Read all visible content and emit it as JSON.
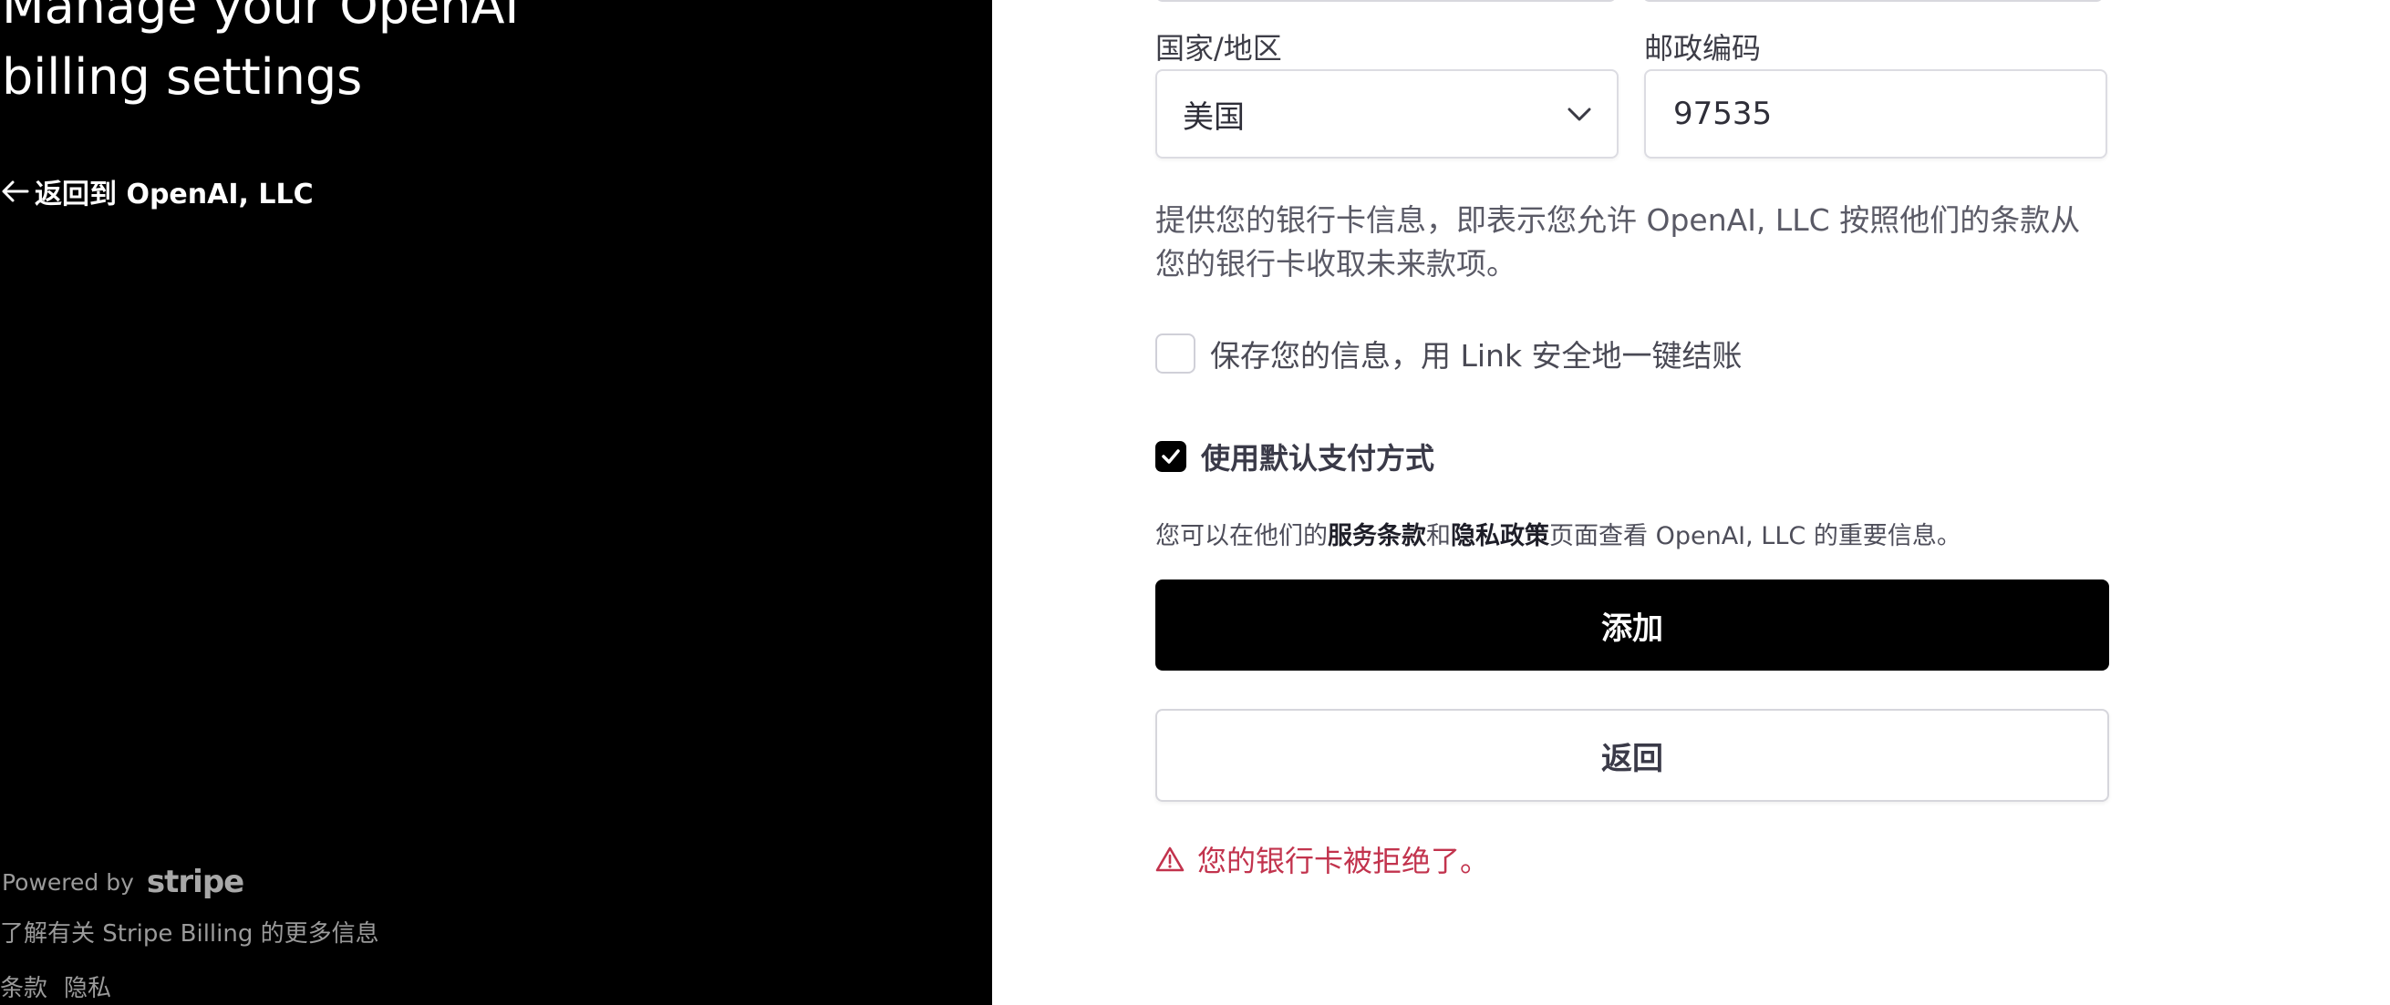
{
  "left": {
    "title": "Manage your OpenAI\nbilling settings",
    "back_link": "返回到 OpenAI, LLC",
    "powered_by": "Powered by",
    "stripe_logo": "stripe",
    "learn_more": "了解有关 Stripe Billing 的更多信息",
    "terms": "条款",
    "privacy": "隐私"
  },
  "form": {
    "country_label": "国家/地区",
    "country_value": "美国",
    "postal_label": "邮政编码",
    "postal_value": "97535",
    "consent": "提供您的银行卡信息，即表示您允许 OpenAI, LLC 按照他们的条款从您的银行卡收取未来款项。",
    "save_link_label": "保存您的信息，用 Link 安全地一键结账",
    "default_payment_label": "使用默认支付方式",
    "info_prefix": "您可以在他们的",
    "terms_of_service": "服务条款",
    "info_and": "和",
    "privacy_policy": "隐私政策",
    "info_suffix": "页面查看 OpenAI, LLC 的重要信息。",
    "add_button": "添加",
    "back_button": "返回",
    "error_message": "您的银行卡被拒绝了。"
  },
  "colors": {
    "left_panel_bg": "#000000",
    "primary_button_bg": "#000000",
    "error": "#c2334d"
  },
  "icons": {
    "back_arrow": "arrow-left-icon",
    "select_chevron": "chevron-down-icon",
    "checkbox_check": "checkmark-icon",
    "error": "warning-triangle-icon"
  },
  "state": {
    "save_with_link_checked": false,
    "use_default_payment_checked": true
  }
}
